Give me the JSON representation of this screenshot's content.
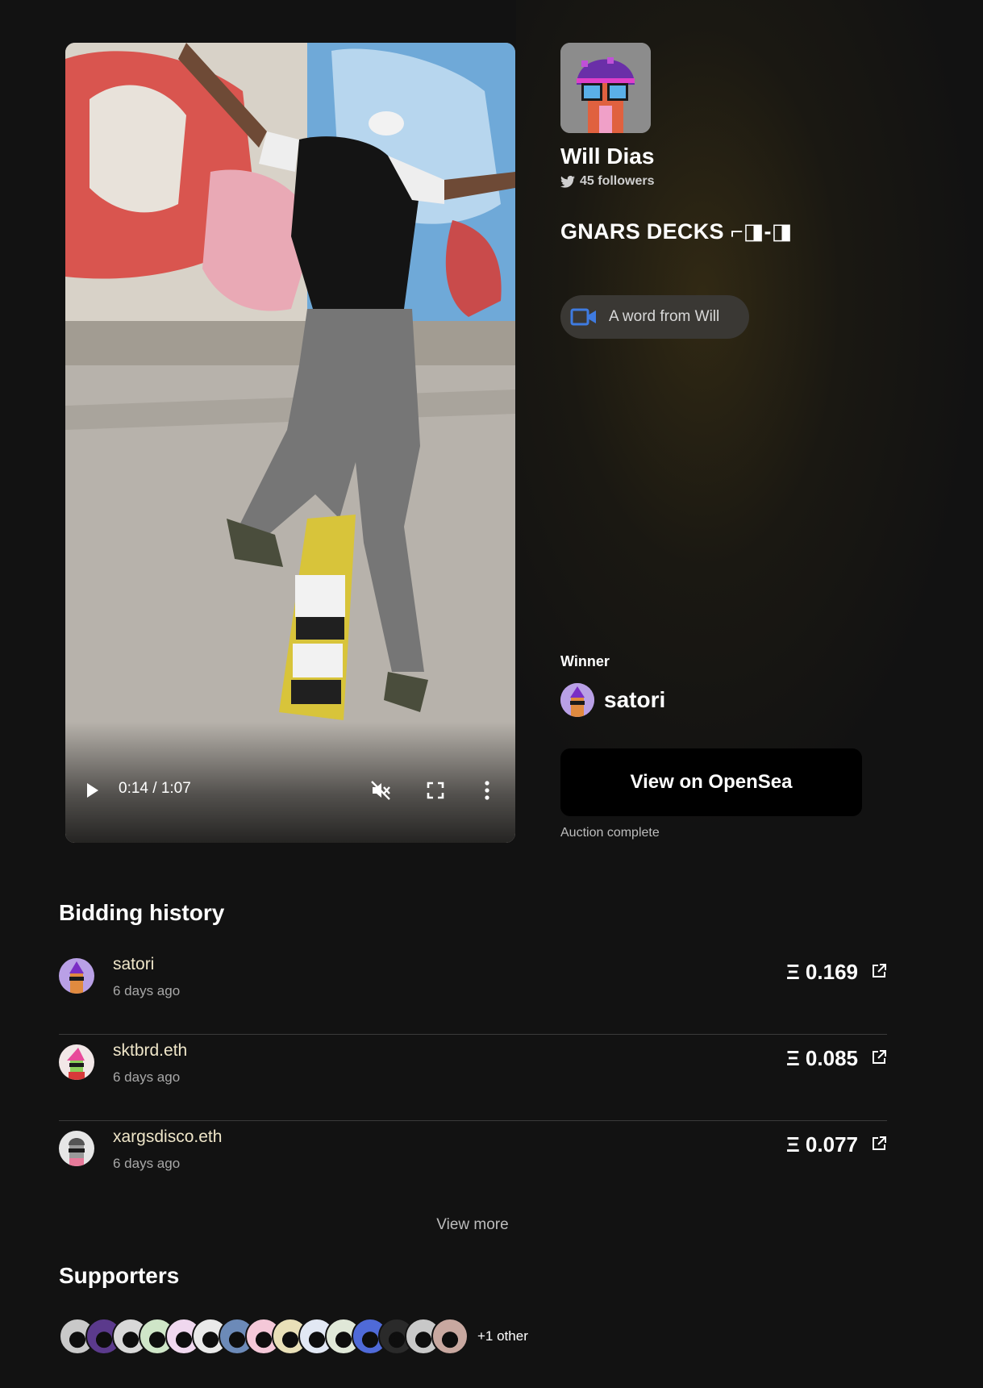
{
  "video": {
    "current_time": "0:14",
    "duration": "1:07",
    "time_display": "0:14 / 1:07",
    "progress_fraction": 0.22,
    "muted": true
  },
  "creator": {
    "name": "Will Dias",
    "followers": "45 followers"
  },
  "auction": {
    "title": "GNARS DECKS ⌐◨-◨",
    "word_button": "A word from Will",
    "winner_label": "Winner",
    "winner_name": "satori",
    "opensea_button": "View on OpenSea",
    "status": "Auction complete"
  },
  "bidding": {
    "heading": "Bidding history",
    "bids": [
      {
        "name": "satori",
        "time": "6 days ago",
        "amount": "Ξ 0.169",
        "avatar_color": "#b9a0e6"
      },
      {
        "name": "sktbrd.eth",
        "time": "6 days ago",
        "amount": "Ξ 0.085",
        "avatar_color": "#f2e7e7"
      },
      {
        "name": "xargsdisco.eth",
        "time": "6 days ago",
        "amount": "Ξ 0.077",
        "avatar_color": "#e6e6e6"
      }
    ],
    "view_more": "View more"
  },
  "supporters": {
    "heading": "Supporters",
    "more_label": "+1 other",
    "avatar_colors": [
      "#c9c9c9",
      "#5b3a8c",
      "#d8d8d8",
      "#cfe6c8",
      "#f0d8ef",
      "#e9e9e9",
      "#6c8ab8",
      "#f4c8d8",
      "#e9e0b8",
      "#e2e8f4",
      "#e0e8d8",
      "#4f6ad8",
      "#2a2a2a",
      "#c8c8c8",
      "#c8a8a0"
    ]
  },
  "icons": {
    "video": "video-camera-icon",
    "twitter": "twitter-icon",
    "external": "external-link-icon",
    "play": "play-icon",
    "mute": "volume-muted-icon",
    "fullscreen": "fullscreen-icon",
    "more": "more-vertical-icon"
  },
  "colors": {
    "background": "#121212",
    "accent_blue": "#3f7be0",
    "button_dark": "#000000"
  }
}
